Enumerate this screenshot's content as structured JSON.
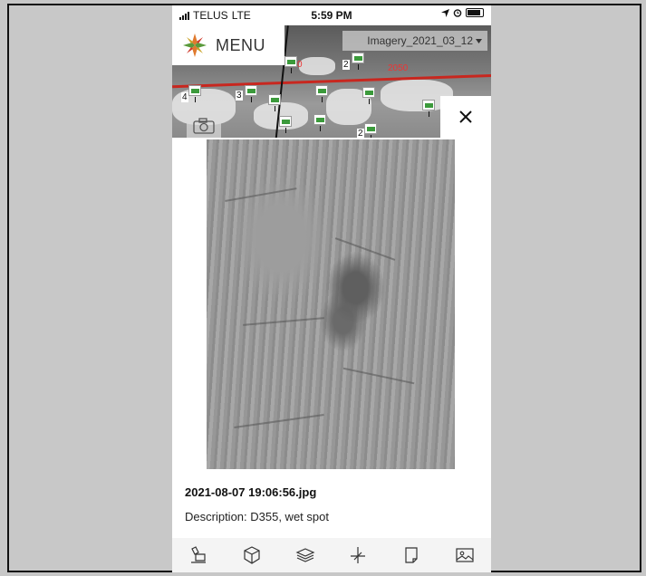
{
  "status_bar": {
    "carrier": "TELUS",
    "network": "LTE",
    "time": "5:59 PM"
  },
  "header": {
    "menu_label": "MENU",
    "layer_selector": "Imagery_2021_03_12"
  },
  "map": {
    "labels": [
      "2050",
      "0"
    ],
    "cluster_counts": [
      "2",
      "4",
      "3",
      "2"
    ]
  },
  "photo": {
    "filename": "2021-08-07 19:06:56.jpg",
    "description": "Description: D355, wet spot"
  },
  "toolbar": {
    "icons": [
      "eraser-icon",
      "cube-icon",
      "layers-icon",
      "crosshair-icon",
      "note-icon",
      "image-icon"
    ]
  },
  "colors": {
    "road": "#c8271f",
    "logo_orange": "#e07a2e",
    "logo_green": "#5a9a3c"
  }
}
